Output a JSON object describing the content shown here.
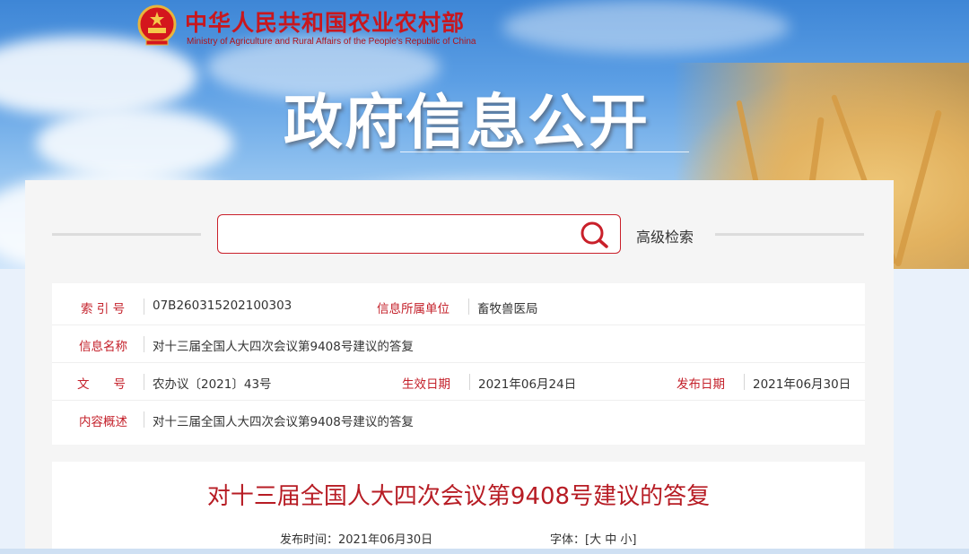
{
  "header": {
    "ministry_cn": "中华人民共和国农业农村部",
    "ministry_en": "Ministry of Agriculture and Rural Affairs of the People's Republic of China",
    "banner_title": "政府信息公开"
  },
  "search": {
    "value": "",
    "placeholder": "",
    "advanced_label": "高级检索"
  },
  "meta": {
    "index_label": "索 引 号",
    "index_value": "07B260315202100303",
    "unit_label": "信息所属单位",
    "unit_value": "畜牧兽医局",
    "name_label": "信息名称",
    "name_value": "对十三届全国人大四次会议第9408号建议的答复",
    "docno_label": "文　　号",
    "docno_value": "农办议〔2021〕43号",
    "effective_label": "生效日期",
    "effective_value": "2021年06月24日",
    "publish_label": "发布日期",
    "publish_value": "2021年06月30日",
    "summary_label": "内容概述",
    "summary_value": "对十三届全国人大四次会议第9408号建议的答复"
  },
  "article": {
    "title": "对十三届全国人大四次会议第9408号建议的答复",
    "published": "发布时间：2021年06月30日",
    "font_size": "字体：[大 中 小]"
  },
  "colors": {
    "brand_red": "#c8171e",
    "label_red": "#c4202a",
    "title_red": "#b71c24"
  },
  "icons": {
    "logo": "national-emblem-icon",
    "search": "search-icon"
  }
}
